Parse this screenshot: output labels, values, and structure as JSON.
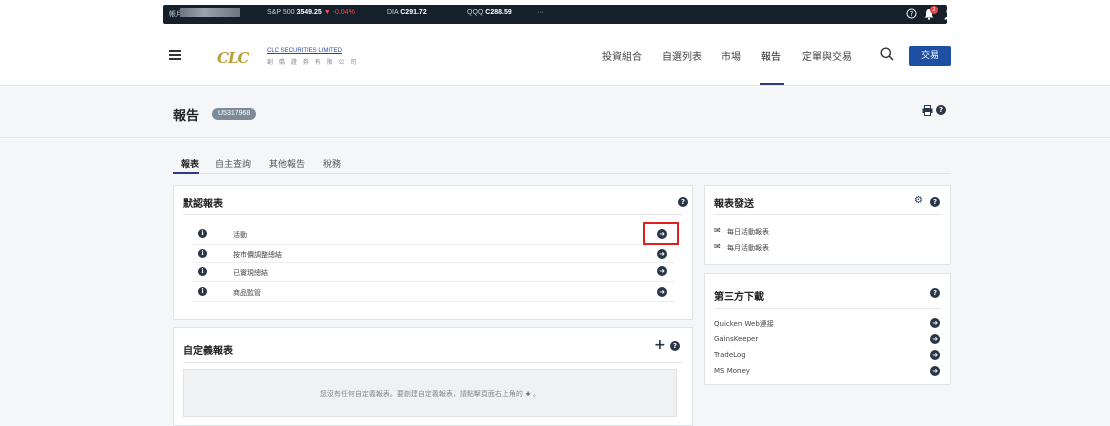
{
  "ticker": {
    "account_label": "帳戶",
    "sp500_label": "S&P 500",
    "sp500_value": "3549.25",
    "sp500_change": "▼ -0.04%",
    "dia_label": "DIA",
    "dia_value": "C291.72",
    "qqq_label": "QQQ",
    "qqq_value": "C288.59",
    "more": "···",
    "notification_count": "2"
  },
  "header": {
    "logo_mark": "CLC",
    "logo_en": "CLC SECURITIES LIMITED",
    "logo_cn": "創 僑 證 券 有 限 公 司",
    "nav": [
      "投資組合",
      "自選列表",
      "市場",
      "報告",
      "定單與交易"
    ],
    "active_nav": "報告",
    "trade_button": "交易"
  },
  "page": {
    "title": "報告",
    "account_id": "U5317968"
  },
  "tabs": [
    "報表",
    "自主查詢",
    "其他報告",
    "稅務"
  ],
  "default_reports": {
    "title": "默認報表",
    "rows": [
      "活動",
      "按市價調整總結",
      "已實現總結",
      "商品監管"
    ]
  },
  "custom_reports": {
    "title": "自定義報表",
    "empty_text": "您沒有任何自定義報表。要創建自定義報表，請點擊頁面右上角的",
    "empty_suffix": "。"
  },
  "report_delivery": {
    "title": "報表發送",
    "items": [
      "每日活動報表",
      "每月活動報表"
    ]
  },
  "third_party": {
    "title": "第三方下載",
    "items": [
      "Quicken Web連接",
      "GainsKeeper",
      "TradeLog",
      "MS Money"
    ]
  },
  "colors": {
    "brand_blue": "#1e4fa3",
    "dark_icon": "#2a3548",
    "highlight_red": "#e02020",
    "logo_gold": "#b99f3a"
  }
}
